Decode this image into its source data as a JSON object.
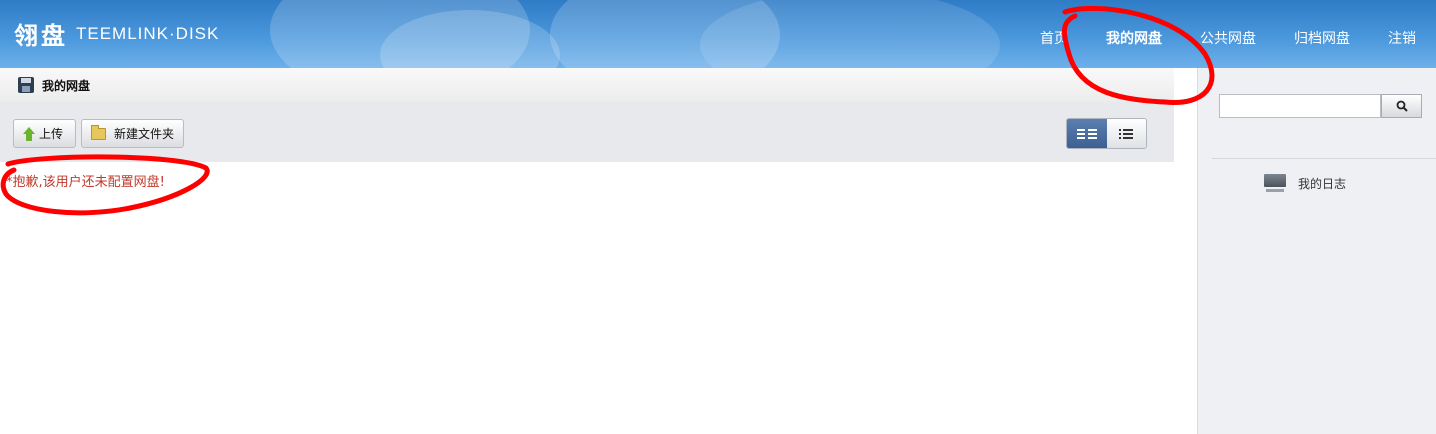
{
  "header": {
    "logo_cn": "翎盘",
    "logo_en": "TEEMLINK·DISK",
    "nav": [
      {
        "label": "首页",
        "active": false
      },
      {
        "label": "我的网盘",
        "active": true
      },
      {
        "label": "公共网盘",
        "active": false
      },
      {
        "label": "归档网盘",
        "active": false
      },
      {
        "label": "注销",
        "active": false
      }
    ]
  },
  "main": {
    "title": "我的网盘",
    "toolbar": {
      "upload_label": "上传",
      "new_folder_label": "新建文件夹"
    },
    "view_modes": [
      {
        "icon": "thumbnail-view-icon",
        "selected": true
      },
      {
        "icon": "list-view-icon",
        "selected": false
      }
    ],
    "message": "*抱歉,该用户还未配置网盘!"
  },
  "sidebar": {
    "search_value": "",
    "search_icon": "search-icon",
    "journal_label": "我的日志"
  },
  "colors": {
    "header_blue": "#3a8ad2",
    "message_red": "#c0392b",
    "annotation_red": "#ff0000",
    "toggle_active": "#4a6c9f"
  }
}
